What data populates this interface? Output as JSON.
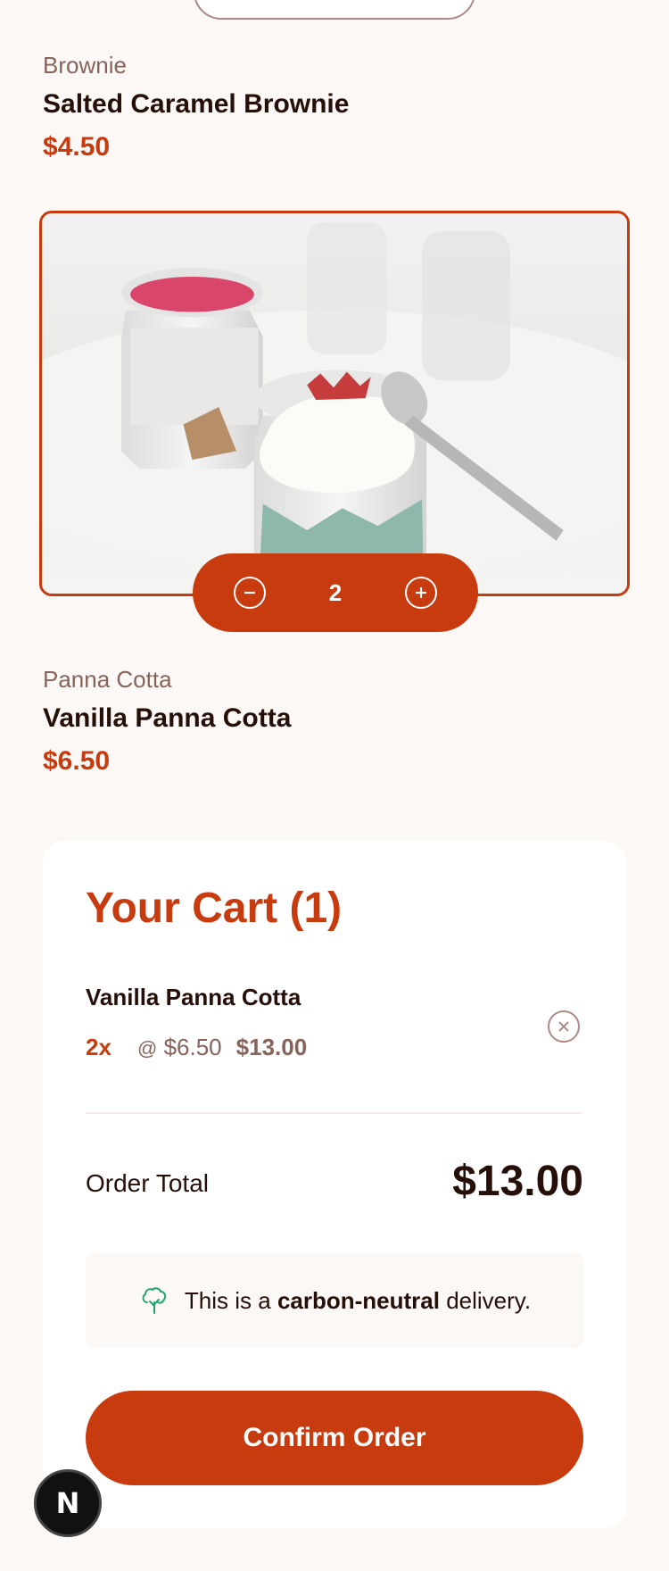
{
  "products": [
    {
      "category": "Brownie",
      "name": "Salted Caramel Brownie",
      "price": "$4.50"
    },
    {
      "category": "Panna Cotta",
      "name": "Vanilla Panna Cotta",
      "price": "$6.50",
      "quantity": "2"
    }
  ],
  "cart": {
    "title": "Your Cart (1)",
    "items": [
      {
        "name": "Vanilla Panna Cotta",
        "qty": "2x",
        "at": "@",
        "unit_price": "$6.50",
        "line_total": "$13.00"
      }
    ],
    "order_total_label": "Order Total",
    "order_total_value": "$13.00",
    "carbon_prefix": "This is a ",
    "carbon_bold": "carbon-neutral",
    "carbon_suffix": " delivery.",
    "confirm_label": "Confirm Order"
  },
  "badge": {
    "letter": "N"
  },
  "colors": {
    "accent": "#c73b0f",
    "text": "#260f08",
    "muted": "#87635a",
    "background": "#fcf8f6",
    "eco": "#1ea575"
  },
  "icons": [
    "decrement-icon",
    "increment-icon",
    "remove-item-icon",
    "carbon-neutral-tree-icon"
  ]
}
